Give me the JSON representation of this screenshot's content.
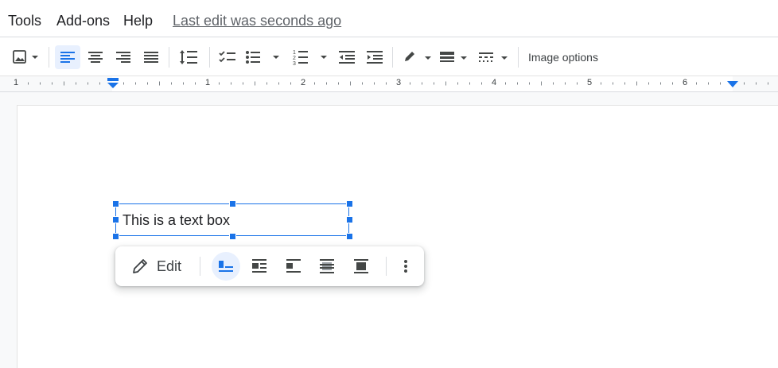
{
  "menu": {
    "items": [
      {
        "label": "Tools"
      },
      {
        "label": "Add-ons"
      },
      {
        "label": "Help"
      }
    ],
    "last_edit": "Last edit was seconds ago"
  },
  "toolbar": {
    "image_options_label": "Image options",
    "buttons": [
      "insert-image-icon",
      "align-left-icon",
      "align-center-icon",
      "align-right-icon",
      "justify-icon",
      "line-spacing-icon",
      "checklist-icon",
      "bulleted-list-icon",
      "numbered-list-icon",
      "decrease-indent-icon",
      "increase-indent-icon",
      "border-color-icon",
      "border-weight-icon",
      "border-dash-icon"
    ],
    "active_alignment": "left"
  },
  "ruler": {
    "numbers": [
      "1",
      "1",
      "2",
      "3",
      "4",
      "5",
      "6"
    ]
  },
  "document": {
    "textbox_text": "This is a text box"
  },
  "floating_toolbar": {
    "edit_label": "Edit",
    "wrap_options": [
      "in-line",
      "wrap-text",
      "break-text",
      "behind-text",
      "in-front-of-text"
    ],
    "active_wrap": "in-line"
  },
  "colors": {
    "accent": "#1a73e8",
    "active_bg": "#e8f0fe",
    "icon": "#444746"
  }
}
